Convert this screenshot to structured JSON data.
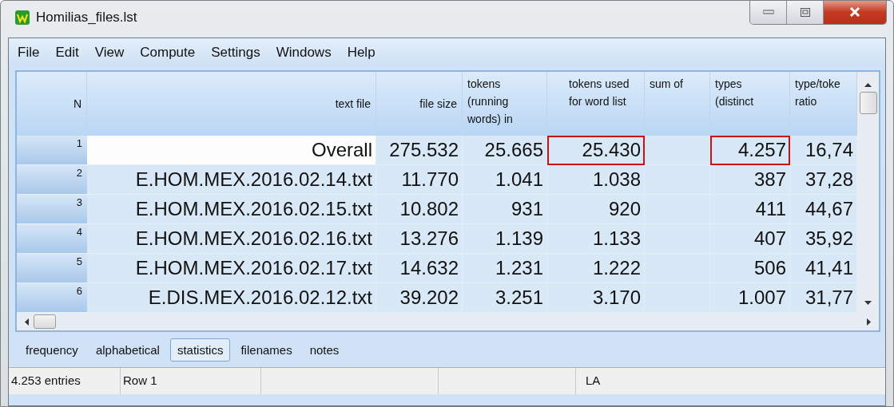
{
  "window": {
    "title": "Homilias_files.lst"
  },
  "menu": [
    "File",
    "Edit",
    "View",
    "Compute",
    "Settings",
    "Windows",
    "Help"
  ],
  "table": {
    "columns": [
      "N",
      "text file",
      "file size",
      "tokens (running words) in",
      "tokens used for word list",
      "sum of",
      "types (distinct",
      "type/toke ratio"
    ],
    "rows": [
      {
        "cells": [
          "1",
          "Overall",
          "275.532",
          "25.665",
          "25.430",
          "",
          "4.257",
          "16,74"
        ],
        "selected": true,
        "tokens_used_boxed": true,
        "types_boxed": true
      },
      {
        "cells": [
          "2",
          "E.HOM.MEX.2016.02.14.txt",
          "11.770",
          "1.041",
          "1.038",
          "",
          "387",
          "37,28"
        ],
        "selected": false,
        "tokens_used_boxed": false,
        "types_boxed": false
      },
      {
        "cells": [
          "3",
          "E.HOM.MEX.2016.02.15.txt",
          "10.802",
          "931",
          "920",
          "",
          "411",
          "44,67"
        ],
        "selected": false,
        "tokens_used_boxed": false,
        "types_boxed": false
      },
      {
        "cells": [
          "4",
          "E.HOM.MEX.2016.02.16.txt",
          "13.276",
          "1.139",
          "1.133",
          "",
          "407",
          "35,92"
        ],
        "selected": false,
        "tokens_used_boxed": false,
        "types_boxed": false
      },
      {
        "cells": [
          "5",
          "E.HOM.MEX.2016.02.17.txt",
          "14.632",
          "1.231",
          "1.222",
          "",
          "506",
          "41,41"
        ],
        "selected": false,
        "tokens_used_boxed": false,
        "types_boxed": false
      },
      {
        "cells": [
          "6",
          "E.DIS.MEX.2016.02.12.txt",
          "39.202",
          "3.251",
          "3.170",
          "",
          "1.007",
          "31,77"
        ],
        "selected": false,
        "tokens_used_boxed": false,
        "types_boxed": false
      }
    ]
  },
  "tabs": [
    {
      "label": "frequency",
      "selected": false
    },
    {
      "label": "alphabetical",
      "selected": false
    },
    {
      "label": "statistics",
      "selected": true
    },
    {
      "label": "filenames",
      "selected": false
    },
    {
      "label": "notes",
      "selected": false
    }
  ],
  "status_bar": {
    "entries": "4.253 entries",
    "row": "Row 1",
    "language": "LA"
  }
}
